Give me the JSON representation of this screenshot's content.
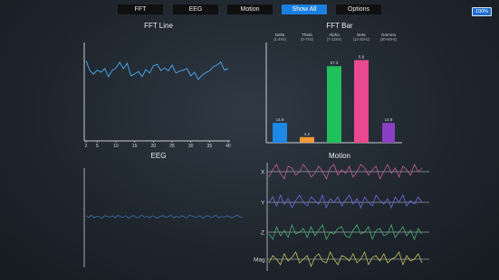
{
  "tabs": [
    {
      "label": "FFT",
      "active": false
    },
    {
      "label": "EEG",
      "active": false
    },
    {
      "label": "Motion",
      "active": false
    },
    {
      "label": "Show All",
      "active": true
    },
    {
      "label": "Options",
      "active": false
    }
  ],
  "battery": "100%",
  "panels": {
    "fft_line_title": "FFT Line",
    "fft_bar_title": "FFT Bar",
    "eeg_title": "EEG",
    "motion_title": "Motion"
  },
  "colors": {
    "line": "#4a9fe0",
    "delta": "#1e88e5",
    "theta": "#f39a3a",
    "alpha": "#1ec15a",
    "beta": "#e9498f",
    "gamma": "#8a3fc6",
    "axis": "#c8ccd2"
  },
  "chart_data": [
    {
      "type": "line",
      "title": "FFT Line",
      "x_ticks": [
        "2",
        "5",
        "10",
        "15",
        "20",
        "25",
        "30",
        "35",
        "40"
      ],
      "x": [
        2,
        3,
        4,
        5,
        6,
        7,
        8,
        9,
        10,
        11,
        12,
        13,
        14,
        15,
        16,
        17,
        18,
        19,
        20,
        21,
        22,
        23,
        24,
        25,
        26,
        27,
        28,
        29,
        30,
        31,
        32,
        33,
        34,
        35,
        36,
        37,
        38,
        39,
        40
      ],
      "values": [
        0.82,
        0.55,
        0.45,
        0.56,
        0.5,
        0.6,
        0.38,
        0.55,
        0.62,
        0.78,
        0.6,
        0.75,
        0.4,
        0.45,
        0.52,
        0.38,
        0.58,
        0.48,
        0.68,
        0.72,
        0.55,
        0.62,
        0.54,
        0.7,
        0.48,
        0.53,
        0.56,
        0.6,
        0.4,
        0.5,
        0.3,
        0.42,
        0.49,
        0.54,
        0.65,
        0.7,
        0.78,
        0.56,
        0.6
      ],
      "ylim": [
        0,
        1
      ]
    },
    {
      "type": "bar",
      "title": "FFT Bar",
      "categories": [
        "Delta\n(1-4Hz)",
        "Theta\n(4-7Hz)",
        "Alpha\n(7-13Hz)",
        "Beta\n(13-30Hz)",
        "Gamma\n(30-60Hz)"
      ],
      "values": [
        14.8,
        4.2,
        57.3,
        61.8,
        14.8
      ],
      "value_labels": [
        "14.8",
        "4.2",
        "57.3",
        "5.8",
        "14.8"
      ],
      "ylim": [
        0,
        75
      ]
    },
    {
      "type": "line",
      "title": "EEG",
      "values": [
        0.02,
        -0.01,
        0.03,
        -0.02,
        0.01,
        0.0,
        -0.03,
        0.02,
        0.01,
        -0.01,
        0.02,
        -0.02,
        0.03,
        0.0,
        -0.01,
        0.02,
        -0.03,
        0.01,
        0.02,
        -0.02,
        0.0,
        0.03,
        -0.01,
        0.01,
        -0.02,
        0.02,
        0.0,
        -0.03,
        0.01,
        0.02,
        -0.01,
        0.0,
        0.03,
        -0.02,
        0.01,
        -0.01,
        0.02,
        0.0,
        -0.02,
        0.03,
        0.01,
        -0.01,
        0.0,
        0.02,
        -0.03,
        0.01,
        0.02,
        -0.01,
        0.0,
        0.03,
        -0.02,
        0.01,
        -0.01,
        0.02,
        0.0,
        -0.02,
        0.01,
        0.03,
        -0.01,
        0.0
      ],
      "ylim": [
        -1,
        1
      ]
    },
    {
      "type": "line",
      "title": "Motion",
      "series": [
        {
          "name": "X",
          "color": "#c85a9a",
          "values": [
            0.2,
            0.6,
            0.9,
            0.4,
            0.1,
            0.8,
            0.7,
            0.3,
            0.5,
            0.9,
            0.6,
            0.2,
            0.4,
            0.8,
            0.5,
            0.1,
            0.7,
            0.9,
            0.3,
            0.6,
            0.4,
            0.8,
            0.2,
            0.5,
            0.9,
            0.7,
            0.3,
            0.6,
            0.8,
            0.1,
            0.5,
            0.9,
            0.4,
            0.7,
            0.2,
            0.8,
            0.6,
            0.3,
            0.9,
            0.5,
            0.7
          ]
        },
        {
          "name": "Y",
          "color": "#6a6ae0",
          "values": [
            0.5,
            0.8,
            0.3,
            0.9,
            0.4,
            0.7,
            0.2,
            0.6,
            0.9,
            0.5,
            0.3,
            0.8,
            0.6,
            0.4,
            0.9,
            0.2,
            0.7,
            0.5,
            0.8,
            0.3,
            0.6,
            0.9,
            0.4,
            0.7,
            0.2,
            0.8,
            0.5,
            0.3,
            0.9,
            0.6,
            0.4,
            0.7,
            0.2,
            0.8,
            0.5,
            0.9,
            0.3,
            0.6,
            0.4,
            0.8,
            0.5
          ]
        },
        {
          "name": "Z",
          "color": "#49b06f",
          "values": [
            0.4,
            0.1,
            0.8,
            0.3,
            0.6,
            0.2,
            0.9,
            0.4,
            0.5,
            0.7,
            0.2,
            0.8,
            0.3,
            0.6,
            0.9,
            0.1,
            0.5,
            0.4,
            0.7,
            0.8,
            0.3,
            0.2,
            0.6,
            0.9,
            0.4,
            0.5,
            0.8,
            0.1,
            0.6,
            0.7,
            0.3,
            0.4,
            0.9,
            0.2,
            0.5,
            0.8,
            0.3,
            0.6,
            0.1,
            0.7,
            0.4
          ]
        },
        {
          "name": "Mag",
          "color": "#c9c25a",
          "values": [
            0.3,
            0.7,
            0.5,
            0.2,
            0.8,
            0.4,
            0.6,
            0.9,
            0.3,
            0.5,
            0.7,
            0.1,
            0.6,
            0.8,
            0.4,
            0.3,
            0.9,
            0.5,
            0.2,
            0.7,
            0.6,
            0.4,
            0.8,
            0.3,
            0.5,
            0.9,
            0.2,
            0.6,
            0.7,
            0.4,
            0.8,
            0.3,
            0.5,
            0.6,
            0.9,
            0.2,
            0.7,
            0.4,
            0.5,
            0.8,
            0.3
          ]
        }
      ]
    }
  ]
}
